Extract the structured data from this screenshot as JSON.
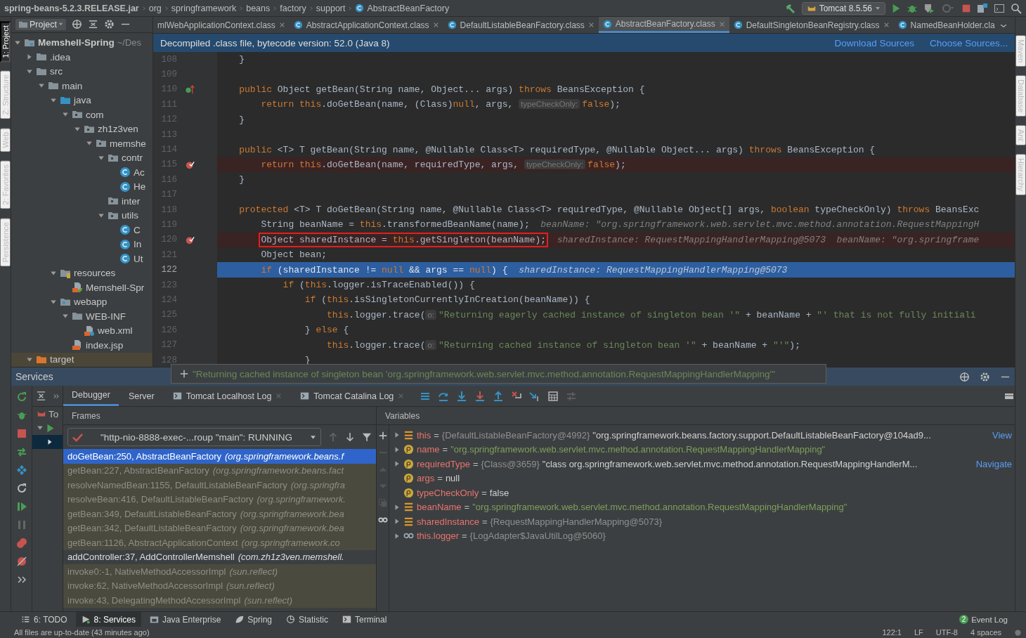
{
  "nav": {
    "breadcrumbs": [
      "spring-beans-5.2.3.RELEASE.jar",
      "org",
      "springframework",
      "beans",
      "factory",
      "support",
      "AbstractBeanFactory"
    ],
    "run_config": "Tomcat 8.5.56"
  },
  "left_stripe": [
    {
      "label": "1: Project",
      "selected": true
    },
    {
      "label": "Z: Structure",
      "selected": false
    },
    {
      "label": "Web",
      "selected": false
    },
    {
      "label": "2: Favorites",
      "selected": false
    },
    {
      "label": "Persistence",
      "selected": false
    }
  ],
  "right_stripe": [
    {
      "label": "Maven",
      "selected": false
    },
    {
      "label": "Database",
      "selected": false
    },
    {
      "label": "Ant",
      "selected": false
    },
    {
      "label": "Hierarchy",
      "selected": false
    }
  ],
  "project": {
    "title": "Project",
    "tree": [
      {
        "label": "Memshell-Spring",
        "path": "~/Des",
        "kind": "module",
        "expanded": true,
        "selected": false,
        "children": [
          {
            "label": ".idea",
            "kind": "folder",
            "expanded": false,
            "selected": false
          },
          {
            "label": "src",
            "kind": "folder",
            "expanded": true,
            "selected": false,
            "children": [
              {
                "label": "main",
                "kind": "folder",
                "expanded": true,
                "selected": false,
                "children": [
                  {
                    "label": "java",
                    "kind": "source",
                    "expanded": true,
                    "selected": false,
                    "children": [
                      {
                        "label": "com",
                        "kind": "package",
                        "expanded": true,
                        "selected": false,
                        "children": [
                          {
                            "label": "zh1z3ven",
                            "kind": "package",
                            "expanded": true,
                            "selected": false,
                            "children": [
                              {
                                "label": "memshe",
                                "kind": "package",
                                "expanded": true,
                                "selected": false,
                                "children": [
                                  {
                                    "label": "contr",
                                    "kind": "package",
                                    "expanded": true,
                                    "selected": false,
                                    "children": [
                                      {
                                        "label": "Ac",
                                        "kind": "class",
                                        "selected": false
                                      },
                                      {
                                        "label": "He",
                                        "kind": "class",
                                        "selected": false
                                      }
                                    ]
                                  },
                                  {
                                    "label": "inter",
                                    "kind": "package",
                                    "selected": false
                                  },
                                  {
                                    "label": "utils",
                                    "kind": "package",
                                    "expanded": true,
                                    "selected": false,
                                    "children": [
                                      {
                                        "label": "C",
                                        "kind": "class",
                                        "selected": false
                                      },
                                      {
                                        "label": "In",
                                        "kind": "class",
                                        "selected": false
                                      },
                                      {
                                        "label": "Ut",
                                        "kind": "class",
                                        "selected": false
                                      }
                                    ]
                                  }
                                ]
                              }
                            ]
                          }
                        ]
                      }
                    ]
                  },
                  {
                    "label": "resources",
                    "kind": "resources",
                    "expanded": true,
                    "selected": false,
                    "children": [
                      {
                        "label": "Memshell-Spr",
                        "kind": "spring-xml",
                        "selected": false
                      }
                    ]
                  },
                  {
                    "label": "webapp",
                    "kind": "webapp",
                    "expanded": true,
                    "selected": false,
                    "children": [
                      {
                        "label": "WEB-INF",
                        "kind": "folder",
                        "expanded": true,
                        "selected": false,
                        "children": [
                          {
                            "label": "web.xml",
                            "kind": "xml",
                            "selected": false
                          }
                        ]
                      },
                      {
                        "label": "index.jsp",
                        "kind": "jsp",
                        "selected": false
                      }
                    ]
                  }
                ]
              }
            ]
          },
          {
            "label": "target",
            "kind": "excluded",
            "expanded": true,
            "selected": true
          }
        ]
      }
    ]
  },
  "editor": {
    "tabs": [
      {
        "label": "mlWebApplicationContext.class",
        "selected": false,
        "icon": false
      },
      {
        "label": "AbstractApplicationContext.class",
        "selected": false,
        "icon": true
      },
      {
        "label": "DefaultListableBeanFactory.class",
        "selected": false,
        "icon": true
      },
      {
        "label": "AbstractBeanFactory.class",
        "selected": true,
        "icon": true
      },
      {
        "label": "DefaultSingletonBeanRegistry.class",
        "selected": false,
        "icon": true
      },
      {
        "label": "NamedBeanHolder.cla",
        "selected": false,
        "icon": true
      }
    ],
    "banner": {
      "text": "Decompiled .class file, bytecode version: 52.0 (Java 8)",
      "links": [
        "Download Sources",
        "Choose Sources..."
      ]
    },
    "lines": [
      {
        "number": "108",
        "breakpoint": false,
        "current": false,
        "overrides": false,
        "code": [
          {
            "kind": "plain",
            "text": "    }"
          }
        ]
      },
      {
        "number": "109",
        "breakpoint": false,
        "current": false,
        "overrides": false
      },
      {
        "number": "110",
        "breakpoint": false,
        "current": false,
        "overrides": true,
        "code": [
          {
            "kind": "keyword",
            "text": "    public"
          },
          {
            "kind": "plain",
            "text": " Object getBean(String name, Object... args) "
          },
          {
            "kind": "keyword",
            "text": "throws"
          },
          {
            "kind": "plain",
            "text": " BeansException {"
          }
        ]
      },
      {
        "number": "111",
        "breakpoint": false,
        "current": false,
        "overrides": false,
        "code": [
          {
            "kind": "keyword",
            "text": "        return this"
          },
          {
            "kind": "plain",
            "text": ".doGetBean(name, (Class)"
          },
          {
            "kind": "keyword",
            "text": "null"
          },
          {
            "kind": "plain",
            "text": ", args, "
          },
          {
            "kind": "hint",
            "text": "typeCheckOnly:"
          },
          {
            "kind": "keyword",
            "text": "false"
          },
          {
            "kind": "plain",
            "text": ");"
          }
        ]
      },
      {
        "number": "112",
        "breakpoint": false,
        "current": false,
        "overrides": false,
        "code": [
          {
            "kind": "plain",
            "text": "    }"
          }
        ]
      },
      {
        "number": "113",
        "breakpoint": false,
        "current": false,
        "overrides": false
      },
      {
        "number": "114",
        "breakpoint": false,
        "current": false,
        "overrides": false,
        "code": [
          {
            "kind": "keyword",
            "text": "    public"
          },
          {
            "kind": "plain",
            "text": " <T> T getBean(String name, @Nullable Class<T> requiredType, @Nullable Object... args) "
          },
          {
            "kind": "keyword",
            "text": "throws"
          },
          {
            "kind": "plain",
            "text": " BeansException {"
          }
        ]
      },
      {
        "number": "115",
        "breakpoint": true,
        "current": false,
        "overrides": false,
        "code": [
          {
            "kind": "keyword",
            "text": "        return this"
          },
          {
            "kind": "plain",
            "text": ".doGetBean(name, requiredType, args, "
          },
          {
            "kind": "hint",
            "text": "typeCheckOnly:"
          },
          {
            "kind": "keyword",
            "text": "false"
          },
          {
            "kind": "plain",
            "text": ");"
          }
        ]
      },
      {
        "number": "116",
        "breakpoint": false,
        "current": false,
        "overrides": false,
        "code": [
          {
            "kind": "plain",
            "text": "    }"
          }
        ]
      },
      {
        "number": "117",
        "breakpoint": false,
        "current": false,
        "overrides": false
      },
      {
        "number": "118",
        "breakpoint": false,
        "current": false,
        "overrides": false,
        "code": [
          {
            "kind": "keyword",
            "text": "    protected"
          },
          {
            "kind": "plain",
            "text": " <T> T doGetBean(String name, @Nullable Class<T> requiredType, @Nullable Object[] args, "
          },
          {
            "kind": "keyword",
            "text": "boolean"
          },
          {
            "kind": "plain",
            "text": " typeCheckOnly) "
          },
          {
            "kind": "keyword",
            "text": "throws"
          },
          {
            "kind": "plain",
            "text": " BeansExc"
          }
        ]
      },
      {
        "number": "119",
        "breakpoint": false,
        "current": false,
        "overrides": false,
        "code": [
          {
            "kind": "plain",
            "text": "        String beanName = "
          },
          {
            "kind": "keyword",
            "text": "this"
          },
          {
            "kind": "plain",
            "text": ".transformedBeanName(name);  "
          },
          {
            "kind": "debug",
            "text": "beanName: \"org.springframework.web.servlet.mvc.method.annotation.RequestMappingH"
          }
        ]
      },
      {
        "number": "120",
        "breakpoint": true,
        "current": false,
        "overrides": false,
        "code": [
          {
            "kind": "plain",
            "text": "        Object sharedInstance = ",
            "boxed": true
          },
          {
            "kind": "keyword",
            "text": "this",
            "boxed": true
          },
          {
            "kind": "plain",
            "text": ".getSingleton(beanName);",
            "boxed": true
          },
          {
            "kind": "debug",
            "text": "  sharedInstance: RequestMappingHandlerMapping@5073  beanName: \"org.springframe"
          }
        ]
      },
      {
        "number": "121",
        "breakpoint": false,
        "current": false,
        "overrides": false,
        "code": [
          {
            "kind": "plain",
            "text": "        Object bean;"
          }
        ]
      },
      {
        "number": "122",
        "breakpoint": false,
        "current": true,
        "overrides": false,
        "code": [
          {
            "kind": "keyword",
            "text": "        if"
          },
          {
            "kind": "plain",
            "text": " (sharedInstance != "
          },
          {
            "kind": "keyword",
            "text": "null"
          },
          {
            "kind": "plain",
            "text": " && args == "
          },
          {
            "kind": "keyword",
            "text": "null"
          },
          {
            "kind": "plain",
            "text": ") {  "
          },
          {
            "kind": "debug",
            "text": "sharedInstance: RequestMappingHandlerMapping@5073"
          }
        ]
      },
      {
        "number": "123",
        "breakpoint": false,
        "current": false,
        "overrides": false,
        "code": [
          {
            "kind": "keyword",
            "text": "            if"
          },
          {
            "kind": "plain",
            "text": " ("
          },
          {
            "kind": "keyword",
            "text": "this"
          },
          {
            "kind": "plain",
            "text": ".logger.isTraceEnabled()) {"
          }
        ]
      },
      {
        "number": "124",
        "breakpoint": false,
        "current": false,
        "overrides": false,
        "code": [
          {
            "kind": "keyword",
            "text": "                if"
          },
          {
            "kind": "plain",
            "text": " ("
          },
          {
            "kind": "keyword",
            "text": "this"
          },
          {
            "kind": "plain",
            "text": ".isSingletonCurrentlyInCreation(beanName)) {"
          }
        ]
      },
      {
        "number": "125",
        "breakpoint": false,
        "current": false,
        "overrides": false,
        "code": [
          {
            "kind": "keyword",
            "text": "                    this"
          },
          {
            "kind": "plain",
            "text": ".logger.trace("
          },
          {
            "kind": "hint",
            "text": "o:"
          },
          {
            "kind": "string",
            "text": "\"Returning eagerly cached instance of singleton bean '\""
          },
          {
            "kind": "plain",
            "text": " + beanName + "
          },
          {
            "kind": "string",
            "text": "\"' that is not fully initiali"
          }
        ]
      },
      {
        "number": "126",
        "breakpoint": false,
        "current": false,
        "overrides": false,
        "code": [
          {
            "kind": "plain",
            "text": "                } "
          },
          {
            "kind": "keyword",
            "text": "else"
          },
          {
            "kind": "plain",
            "text": " {"
          }
        ]
      },
      {
        "number": "127",
        "breakpoint": false,
        "current": false,
        "overrides": false,
        "code": [
          {
            "kind": "keyword",
            "text": "                    this"
          },
          {
            "kind": "plain",
            "text": ".logger.trace("
          },
          {
            "kind": "hint",
            "text": "o:"
          },
          {
            "kind": "string",
            "text": "\"Returning cached instance of singleton bean '\""
          },
          {
            "kind": "plain",
            "text": " + beanName + "
          },
          {
            "kind": "string",
            "text": "\"'\""
          },
          {
            "kind": "plain",
            "text": ");"
          }
        ]
      },
      {
        "number": "128",
        "breakpoint": false,
        "current": false,
        "overrides": false,
        "code": [
          {
            "kind": "plain",
            "text": "                }"
          }
        ]
      }
    ],
    "tooltip": "\"Returning cached instance of singleton bean 'org.springframework.web.servlet.mvc.method.annotation.RequestMappingHandlerMapping'\""
  },
  "services": {
    "title": "Services",
    "tree": [
      {
        "label": "To",
        "kind": "tomcat",
        "selected": false
      },
      {
        "kind": "server",
        "expanded": true,
        "selected": false
      },
      {
        "kind": "deployment",
        "expanded": false,
        "selected": true
      }
    ],
    "tabs": [
      {
        "label": "Debugger",
        "selected": true,
        "closable": false,
        "icon": false
      },
      {
        "label": "Server",
        "selected": false,
        "closable": false,
        "icon": false
      },
      {
        "label": "Tomcat Localhost Log",
        "selected": false,
        "closable": true,
        "icon": true
      },
      {
        "label": "Tomcat Catalina Log",
        "selected": false,
        "closable": true,
        "icon": true
      }
    ],
    "frames": {
      "title": "Frames",
      "thread": "\"http-nio-8888-exec-...roup \"main\": RUNNING",
      "items": [
        {
          "method": "doGetBean:250, AbstractBeanFactory",
          "location": "(org.springframework.beans.f",
          "selected": true,
          "library": true
        },
        {
          "method": "getBean:227, AbstractBeanFactory",
          "location": "(org.springframework.beans.fact",
          "selected": false,
          "library": true
        },
        {
          "method": "resolveNamedBean:1155, DefaultListableBeanFactory",
          "location": "(org.springfra",
          "selected": false,
          "library": true
        },
        {
          "method": "resolveBean:416, DefaultListableBeanFactory",
          "location": "(org.springframework.",
          "selected": false,
          "library": true
        },
        {
          "method": "getBean:349, DefaultListableBeanFactory",
          "location": "(org.springframework.bea",
          "selected": false,
          "library": true
        },
        {
          "method": "getBean:342, DefaultListableBeanFactory",
          "location": "(org.springframework.bea",
          "selected": false,
          "library": true
        },
        {
          "method": "getBean:1126, AbstractApplicationContext",
          "location": "(org.springframework.co",
          "selected": false,
          "library": true
        },
        {
          "method": "addController:37, AddControllerMemshell",
          "location": "(com.zh1z3ven.memshell.",
          "selected": false,
          "library": false
        },
        {
          "method": "invoke0:-1, NativeMethodAccessorImpl",
          "location": "(sun.reflect)",
          "selected": false,
          "library": true
        },
        {
          "method": "invoke:62, NativeMethodAccessorImpl",
          "location": "(sun.reflect)",
          "selected": false,
          "library": true
        },
        {
          "method": "invoke:43, DelegatingMethodAccessorImpl",
          "location": "(sun.reflect)",
          "selected": false,
          "library": true
        }
      ]
    },
    "variables": {
      "title": "Variables",
      "items": [
        {
          "name": "this",
          "eq": "=",
          "kind": "field",
          "expandable": true,
          "ref": "{DefaultListableBeanFactory@4992}",
          "value": {
            "kind": "plain",
            "text": "\"org.springframework.beans.factory.support.DefaultListableBeanFactory@104ad9..."
          },
          "link": "View"
        },
        {
          "name": "name",
          "eq": "=",
          "kind": "param",
          "expandable": true,
          "value": {
            "kind": "string",
            "text": "\"org.springframework.web.servlet.mvc.method.annotation.RequestMappingHandlerMapping\""
          }
        },
        {
          "name": "requiredType",
          "eq": "=",
          "kind": "param",
          "expandable": true,
          "ref": "{Class@3659}",
          "value": {
            "kind": "plain",
            "text": "\"class org.springframework.web.servlet.mvc.method.annotation.RequestMappingHandlerM..."
          },
          "link": "Navigate"
        },
        {
          "name": "args",
          "eq": "=",
          "kind": "param",
          "expandable": false,
          "value": {
            "kind": "plain",
            "text": "null"
          }
        },
        {
          "name": "typeCheckOnly",
          "eq": "=",
          "kind": "param",
          "expandable": false,
          "value": {
            "kind": "plain",
            "text": "false"
          }
        },
        {
          "name": "beanName",
          "eq": "=",
          "kind": "field",
          "expandable": true,
          "value": {
            "kind": "string",
            "text": "\"org.springframework.web.servlet.mvc.method.annotation.RequestMappingHandlerMapping\""
          }
        },
        {
          "name": "sharedInstance",
          "eq": "=",
          "kind": "field",
          "expandable": true,
          "ref": "{RequestMappingHandlerMapping@5073}"
        },
        {
          "name": "this.logger",
          "eq": "=",
          "kind": "watch",
          "expandable": true,
          "ref": "{LogAdapter$JavaUtilLog@5060}"
        }
      ]
    }
  },
  "tool_buttons": [
    {
      "label": "6: TODO",
      "selected": false,
      "kind": "todo"
    },
    {
      "label": "8: Services",
      "selected": true,
      "kind": "services"
    },
    {
      "label": "Java Enterprise",
      "selected": false,
      "kind": "enterprise"
    },
    {
      "label": "Spring",
      "selected": false,
      "kind": "spring"
    },
    {
      "label": "Statistic",
      "selected": false,
      "kind": "statistic"
    },
    {
      "label": "Terminal",
      "selected": false,
      "kind": "terminal"
    }
  ],
  "event_log": {
    "label": "Event Log",
    "badge": "2"
  },
  "status_bar": {
    "message": "All files are up-to-date (43 minutes ago)",
    "items": [
      "122:1",
      "LF",
      "UTF-8",
      "4 spaces"
    ]
  }
}
